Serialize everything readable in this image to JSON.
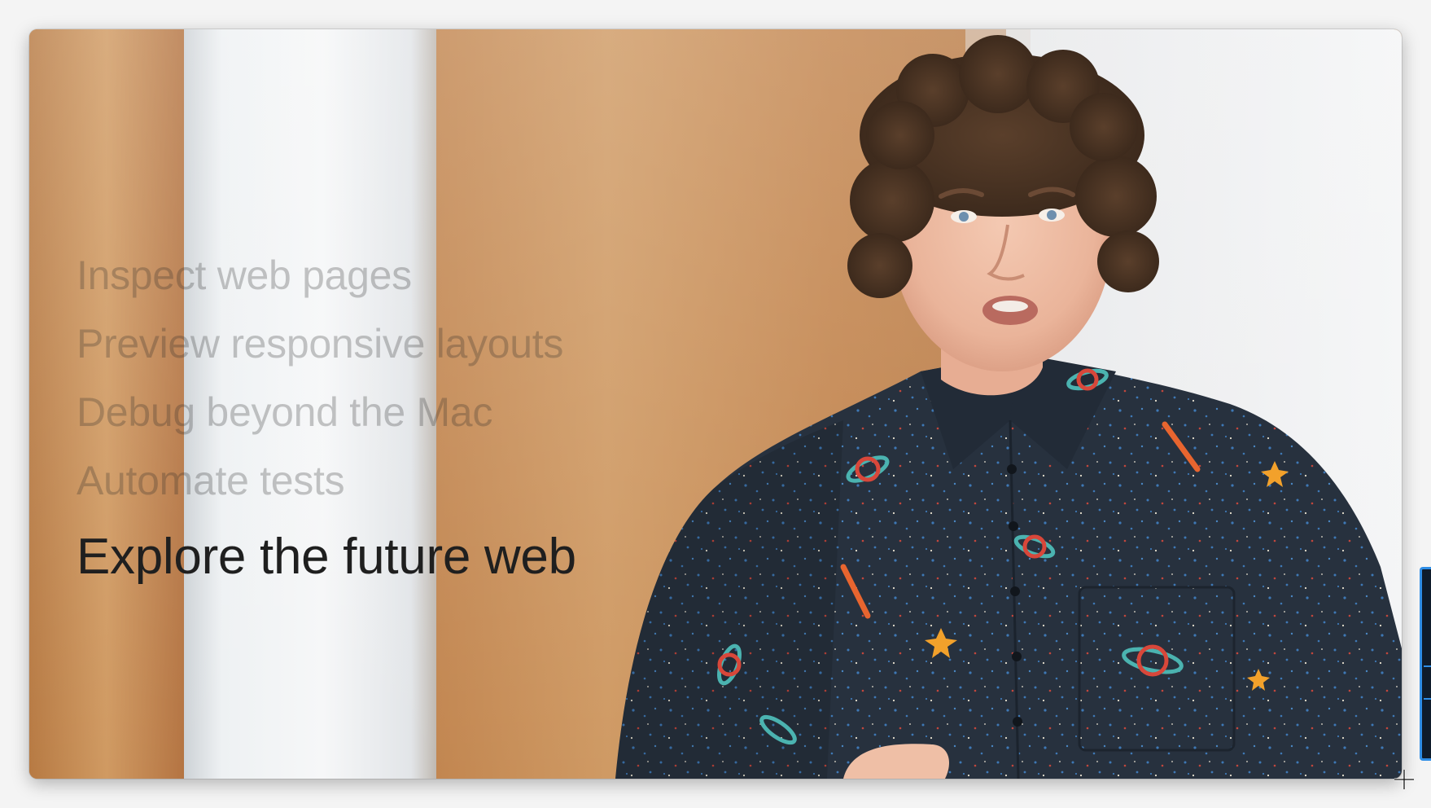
{
  "video": {
    "topics": [
      {
        "label": "Inspect web pages",
        "active": false
      },
      {
        "label": "Preview responsive layouts",
        "active": false
      },
      {
        "label": "Debug beyond the Mac",
        "active": false
      },
      {
        "label": "Automate tests",
        "active": false
      },
      {
        "label": "Explore the future web",
        "active": true
      }
    ],
    "scene": {
      "subject": "presenter",
      "background": "wood-panel wall with frosted glass columns",
      "colors": {
        "wood": "#c98a4f",
        "glass": "#e9ecef",
        "shirt": "#26313f",
        "skin": "#f0bfa6",
        "hair": "#4a3424"
      }
    },
    "text_colors": {
      "inactive": "rgba(40,40,40,0.26)",
      "active": "#1f1f1f"
    }
  },
  "cursor": {
    "icon": "crosshair-resize-icon"
  }
}
